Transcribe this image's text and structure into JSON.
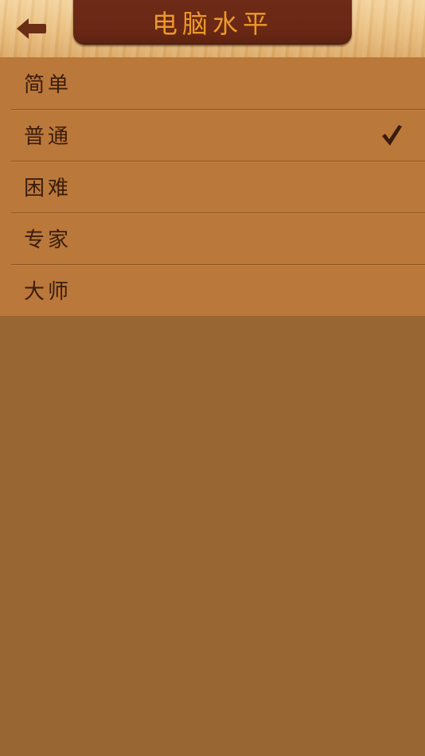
{
  "header": {
    "title": "电脑水平",
    "back_icon": "back-arrow-icon"
  },
  "levels": [
    {
      "label": "简单",
      "selected": false
    },
    {
      "label": "普通",
      "selected": true
    },
    {
      "label": "困难",
      "selected": false
    },
    {
      "label": "专家",
      "selected": false
    },
    {
      "label": "大师",
      "selected": false
    }
  ],
  "colors": {
    "header_wood": "#e9bd7c",
    "title_plate": "#6a2815",
    "title_text": "#ec9a2a",
    "list_bg": "#ba783a",
    "page_bg": "#986632",
    "item_text": "#3a1c0c",
    "check": "#3a1c0c"
  }
}
